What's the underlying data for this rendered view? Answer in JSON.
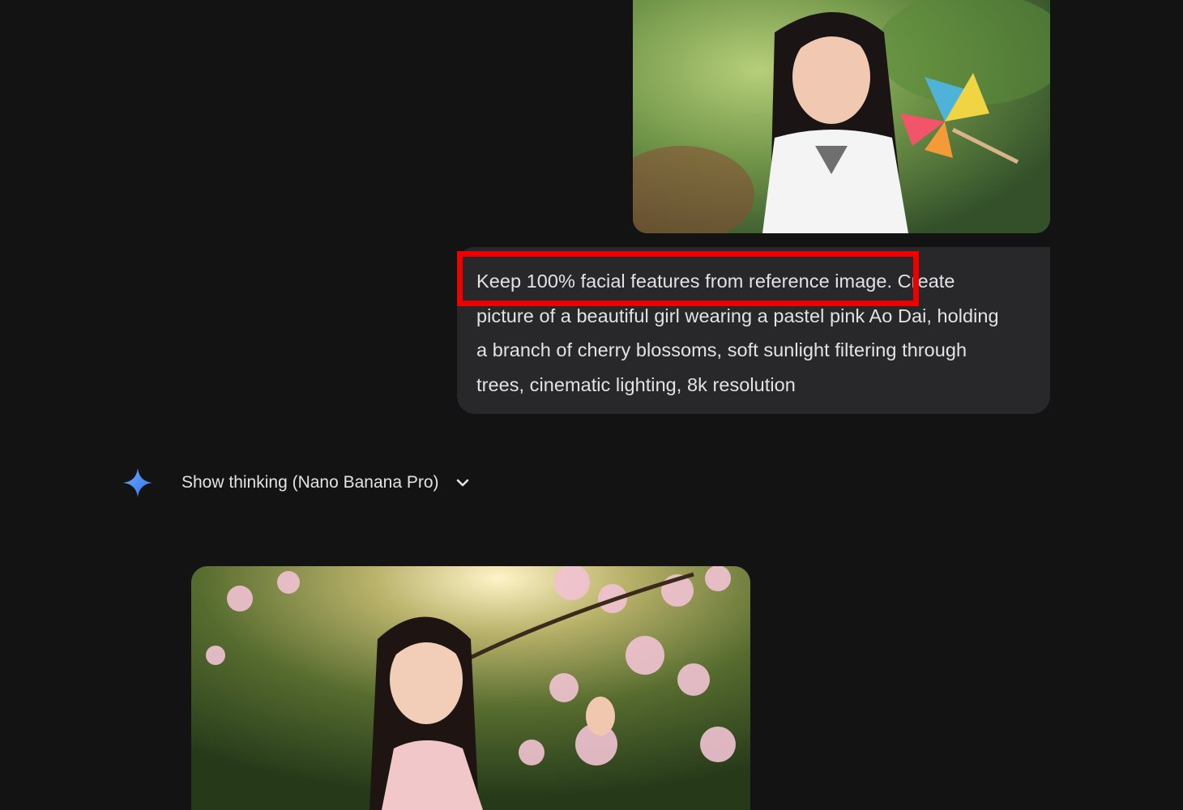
{
  "conversation": {
    "user_message": {
      "image_icon": "photo-reference",
      "prompt_lines": [
        "Keep 100% facial features from reference image. Create",
        "picture of a beautiful girl wearing a pastel pink Ao Dai, holding",
        "a branch of cherry blossoms, soft sunlight filtering through",
        "trees, cinematic lighting, 8k resolution"
      ],
      "highlight_color": "#ef0000"
    },
    "model_response": {
      "icon": "gemini-sparkle-icon",
      "show_thinking_label": "Show thinking (Nano Banana Pro)",
      "toggle_icon": "chevron-down-icon",
      "image_icon": "photo-generated"
    }
  },
  "colors": {
    "background": "#131314",
    "bubble": "#28282a",
    "text": "#e3e3e3",
    "sparkle_blue": "#4a8ff7"
  }
}
